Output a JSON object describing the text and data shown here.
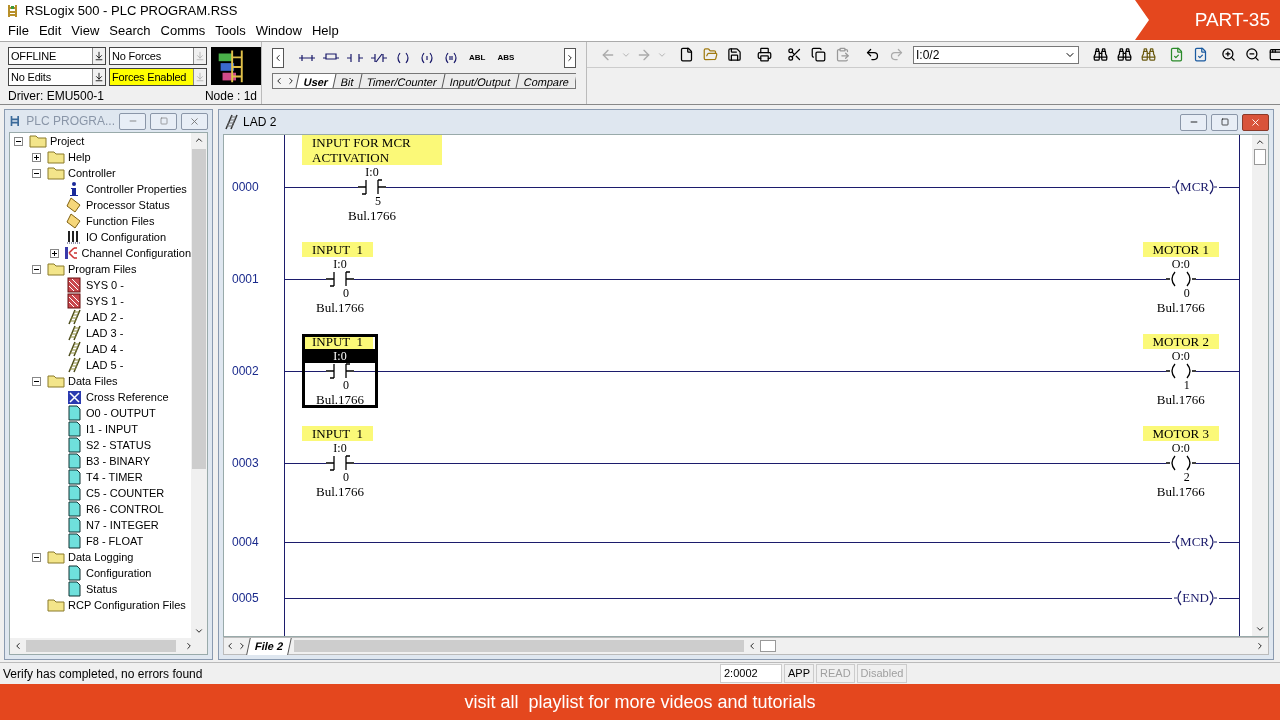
{
  "window": {
    "title": "RSLogix 500 - PLC PROGRAM.RSS"
  },
  "banner": {
    "text": "PART-35"
  },
  "menu": [
    "File",
    "Edit",
    "View",
    "Search",
    "Comms",
    "Tools",
    "Window",
    "Help"
  ],
  "mode_fields": [
    {
      "value": "OFFLINE",
      "color": "#ffffff",
      "disabled": false
    },
    {
      "value": "No Forces",
      "color": "#ffffff",
      "disabled": true
    },
    {
      "value": "No Edits",
      "color": "#ffffff",
      "disabled": false
    },
    {
      "value": "Forces Enabled",
      "color": "#ffff00",
      "disabled": true
    }
  ],
  "driver": "Driver: EMU500-1",
  "node": "Node : 1d",
  "palette": {
    "text_buttons": [
      "ABL",
      "ABS"
    ],
    "tabs": [
      {
        "label": "User",
        "selected": true
      },
      {
        "label": "Bit",
        "selected": false
      },
      {
        "label": "Timer/Counter",
        "selected": false
      },
      {
        "label": "Input/Output",
        "selected": false
      },
      {
        "label": "Compare",
        "selected": false
      }
    ]
  },
  "toolbar": {
    "address_combo": "I:0/2"
  },
  "project_panel": {
    "title": "PLC PROGRA...",
    "tree": [
      {
        "label": "Project",
        "kind": "folder",
        "expanded": true,
        "children": [
          {
            "label": "Help",
            "kind": "folder",
            "expanded": false
          },
          {
            "label": "Controller",
            "kind": "folder",
            "expanded": true,
            "children": [
              {
                "label": "Controller Properties",
                "kind": "info"
              },
              {
                "label": "Processor Status",
                "kind": "note"
              },
              {
                "label": "Function Files",
                "kind": "note"
              },
              {
                "label": "IO Configuration",
                "kind": "io"
              },
              {
                "label": "Channel Configuration",
                "kind": "channel",
                "expanded": false
              }
            ]
          },
          {
            "label": "Program Files",
            "kind": "folder",
            "expanded": true,
            "children": [
              {
                "label": "SYS 0 -",
                "kind": "sys"
              },
              {
                "label": "SYS 1 -",
                "kind": "sys"
              },
              {
                "label": "LAD 2 -",
                "kind": "lad"
              },
              {
                "label": "LAD 3 -",
                "kind": "lad"
              },
              {
                "label": "LAD 4 -",
                "kind": "lad"
              },
              {
                "label": "LAD 5 -",
                "kind": "lad"
              }
            ]
          },
          {
            "label": "Data Files",
            "kind": "folder",
            "expanded": true,
            "children": [
              {
                "label": "Cross Reference",
                "kind": "cross"
              },
              {
                "label": "O0 - OUTPUT",
                "kind": "data"
              },
              {
                "label": "I1 - INPUT",
                "kind": "data"
              },
              {
                "label": "S2 - STATUS",
                "kind": "data"
              },
              {
                "label": "B3 - BINARY",
                "kind": "data"
              },
              {
                "label": "T4 - TIMER",
                "kind": "data"
              },
              {
                "label": "C5 - COUNTER",
                "kind": "data"
              },
              {
                "label": "R6 - CONTROL",
                "kind": "data"
              },
              {
                "label": "N7 - INTEGER",
                "kind": "data"
              },
              {
                "label": "F8 - FLOAT",
                "kind": "data"
              }
            ]
          },
          {
            "label": "Data Logging",
            "kind": "folder",
            "expanded": true,
            "children": [
              {
                "label": "Configuration",
                "kind": "data"
              },
              {
                "label": "Status",
                "kind": "data"
              }
            ]
          },
          {
            "label": "RCP Configuration Files",
            "kind": "folder"
          }
        ]
      }
    ]
  },
  "ladder_window": {
    "title": "LAD 2",
    "file_tab": "File 2",
    "rungs": [
      {
        "number": "0000",
        "left": {
          "kind": "contact",
          "label": "INPUT FOR MCR ACTIVATION",
          "address": "I:0",
          "bit": "5",
          "module": "Bul.1766",
          "selected": false
        },
        "right": {
          "kind": "text_coil",
          "text": "MCR"
        }
      },
      {
        "number": "0001",
        "left": {
          "kind": "contact",
          "label": "INPUT  1",
          "address": "I:0",
          "bit": "0",
          "module": "Bul.1766",
          "selected": false
        },
        "right": {
          "kind": "coil",
          "label": "MOTOR 1",
          "address": "O:0",
          "bit": "0",
          "module": "Bul.1766"
        }
      },
      {
        "number": "0002",
        "left": {
          "kind": "contact",
          "label": "INPUT  1",
          "address": "I:0",
          "bit": "0",
          "module": "Bul.1766",
          "selected": true
        },
        "right": {
          "kind": "coil",
          "label": "MOTOR 2",
          "address": "O:0",
          "bit": "1",
          "module": "Bul.1766"
        }
      },
      {
        "number": "0003",
        "left": {
          "kind": "contact",
          "label": "INPUT  1",
          "address": "I:0",
          "bit": "0",
          "module": "Bul.1766",
          "selected": false
        },
        "right": {
          "kind": "coil",
          "label": "MOTOR 3",
          "address": "O:0",
          "bit": "2",
          "module": "Bul.1766"
        }
      },
      {
        "number": "0004",
        "right": {
          "kind": "text_coil",
          "text": "MCR"
        }
      },
      {
        "number": "0005",
        "right": {
          "kind": "text_coil",
          "text": "END"
        }
      }
    ]
  },
  "status_bar": {
    "message": "Verify has completed, no errors found",
    "fields": [
      {
        "text": "2:0002",
        "disabled": false
      },
      {
        "text": "APP",
        "disabled": false
      },
      {
        "text": "READ",
        "disabled": true
      },
      {
        "text": "Disabled",
        "disabled": true
      }
    ]
  },
  "footer": {
    "text": "visit all  playlist for more videos and tutorials"
  }
}
